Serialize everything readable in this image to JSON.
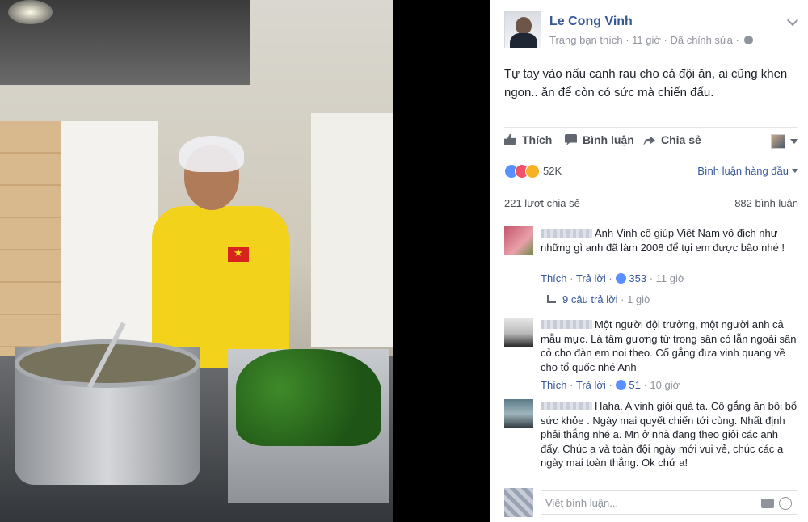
{
  "post": {
    "author": "Le Cong Vinh",
    "meta_page": "Trang bạn thích",
    "meta_time": "11 giờ",
    "meta_edited": "Đã chỉnh sửa",
    "text": "Tự tay vào nấu canh rau cho cả đội ăn, ai cũng khen ngon.. ăn để còn có sức mà chiến đấu."
  },
  "actions": {
    "like": "Thích",
    "comment": "Bình luận",
    "share": "Chia sẻ"
  },
  "stats": {
    "reactions": "52K",
    "sort_label": "Bình luận hàng đầu",
    "shares": "221 lượt chia sẻ",
    "comments": "882 bình luận"
  },
  "comments": [
    {
      "text": "Anh Vinh cố giúp Việt Nam vô địch như những gì anh đã làm 2008 để tụi em được bão nhé !",
      "like": "Thích",
      "reply": "Trả lời",
      "likes": "353",
      "time": "11 giờ"
    },
    {
      "text": "Một người đội trưởng, một người anh cả mẫu mực. Là tấm gương từ trong sân cỏ lẫn ngoài sân cỏ cho đàn em noi theo. Cố gắng đưa vinh quang về cho tổ quốc nhé Anh",
      "like": "Thích",
      "reply": "Trả lời",
      "likes": "51",
      "time": "10 giờ"
    },
    {
      "text": "Haha. A vinh giỏi quá ta. Cố gắng ăn bồi bổ sức khỏe . Ngày mai quyết chiến tới cùng. Nhất định phải thắng nhé a. Mn ở nhà đang theo giỏi các anh đấy. Chúc a và toàn đội ngày mới vui vẻ, chúc các a ngày mai toàn thắng. Ok chứ a!"
    }
  ],
  "replies": {
    "label": "9 câu trả lời",
    "time": "1 giờ"
  },
  "composer": {
    "placeholder": "Viết bình luận..."
  }
}
